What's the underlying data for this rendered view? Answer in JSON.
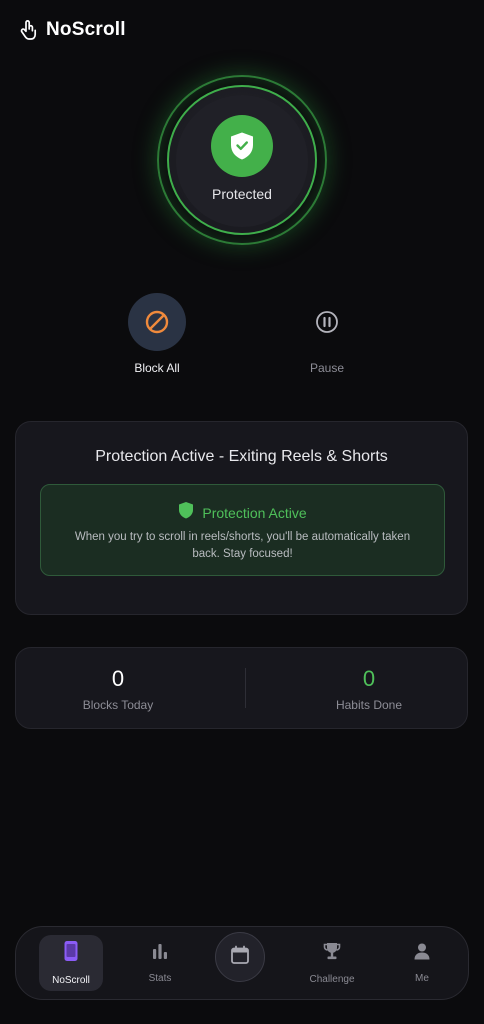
{
  "header": {
    "app_title": "NoScroll",
    "icon": "hand-icon"
  },
  "status": {
    "label": "Protected",
    "icon": "shield-check-icon",
    "accent": "#43b04a"
  },
  "actions": [
    {
      "label": "Block All",
      "icon": "block-icon",
      "selected": true
    },
    {
      "label": "Pause",
      "icon": "pause-icon",
      "selected": false
    }
  ],
  "protection_card": {
    "title": "Protection Active - Exiting Reels & Shorts",
    "banner_title": "Protection Active",
    "banner_text": "When you try to scroll in reels/shorts, you'll be automatically taken back. Stay focused!"
  },
  "stats": {
    "blocks_today": {
      "value": "0",
      "label": "Blocks Today"
    },
    "habits_done": {
      "value": "0",
      "label": "Habits Done"
    }
  },
  "nav": {
    "items": [
      {
        "label": "NoScroll",
        "icon": "phone-icon",
        "active": true
      },
      {
        "label": "Stats",
        "icon": "bar-chart-icon",
        "active": false
      },
      {
        "label": "",
        "icon": "calendar-icon",
        "active": false
      },
      {
        "label": "Challenge",
        "icon": "trophy-icon",
        "active": false
      },
      {
        "label": "Me",
        "icon": "user-icon",
        "active": false
      }
    ]
  },
  "colors": {
    "background": "#0b0b0d",
    "green": "#4fc05a",
    "purple_accent": "#8b5cf6",
    "orange_accent": "#f08a3c"
  }
}
